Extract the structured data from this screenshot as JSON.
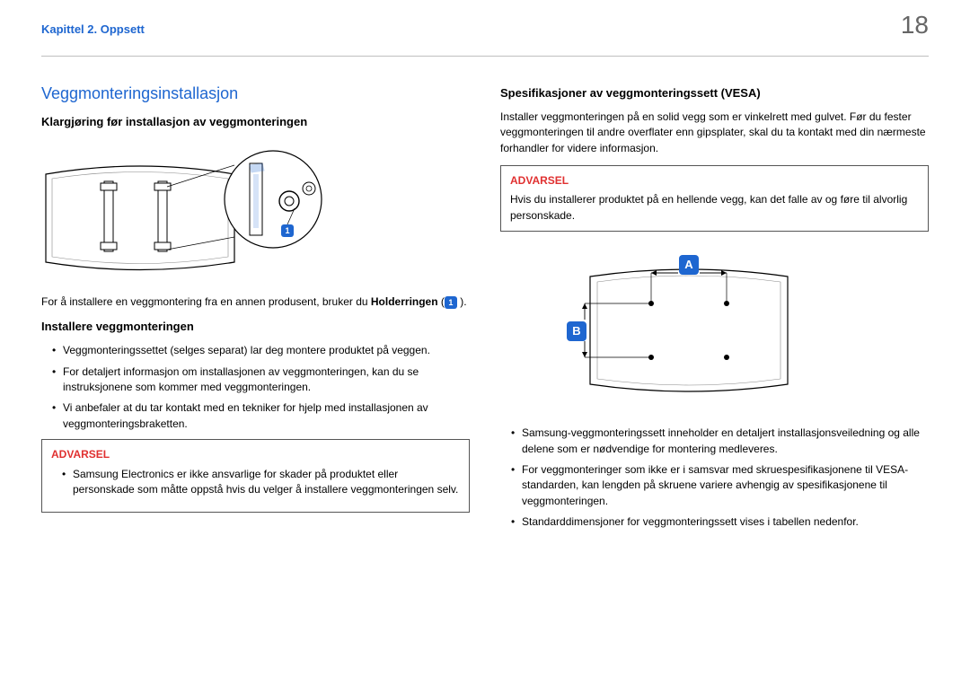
{
  "header": {
    "chapter": "Kapittel 2. Oppsett",
    "page": "18"
  },
  "left": {
    "title": "Veggmonteringsinstallasjon",
    "sub1": "Klargjøring før installasjon av veggmonteringen",
    "callout1": "1",
    "fig_text_pre": "For å installere en veggmontering fra en annen produsent, bruker du ",
    "fig_text_bold": "Holderringen",
    "fig_text_post": " (",
    "fig_text_end": " ).",
    "sub2": "Installere veggmonteringen",
    "bullets": [
      "Veggmonteringssettet (selges separat) lar deg montere produktet på veggen.",
      "For detaljert informasjon om installasjonen av veggmonteringen, kan du se instruksjonene som kommer med veggmonteringen.",
      "Vi anbefaler at du tar kontakt med en tekniker for hjelp med installasjonen av veggmonteringsbraketten."
    ],
    "warn": {
      "title": "ADVARSEL",
      "text": "Samsung Electronics er ikke ansvarlige for skader på produktet eller personskade som måtte oppstå hvis du velger å installere veggmonteringen selv."
    }
  },
  "right": {
    "sub1": "Spesifikasjoner av veggmonteringssett (VESA)",
    "para": "Installer veggmonteringen på en solid vegg som er vinkelrett med gulvet. Før du fester veggmonteringen til andre overflater enn gipsplater, skal du ta kontakt med din nærmeste forhandler for videre informasjon.",
    "warn": {
      "title": "ADVARSEL",
      "text": "Hvis du installerer produktet på en hellende vegg, kan det falle av og føre til alvorlig personskade."
    },
    "calloutA": "A",
    "calloutB": "B",
    "bullets": [
      "Samsung-veggmonteringssett inneholder en detaljert installasjonsveiledning og alle delene som er nødvendige for montering medleveres.",
      "For veggmonteringer som ikke er i samsvar med skruespesifikasjonene til VESA-standarden, kan lengden på skruene variere avhengig av spesifikasjonene til veggmonteringen.",
      "Standarddimensjoner for veggmonteringssett vises i tabellen nedenfor."
    ]
  }
}
